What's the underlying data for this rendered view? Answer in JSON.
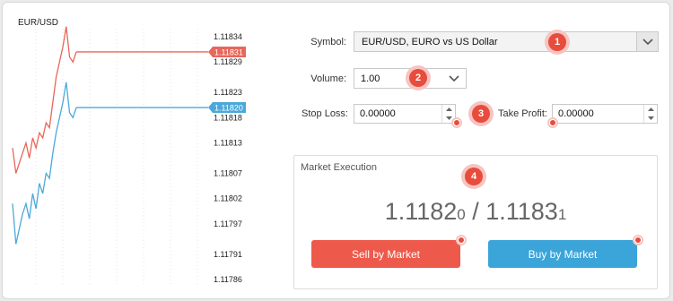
{
  "chart": {
    "symbol": "EUR/USD",
    "ask_value": "1.11831",
    "bid_value": "1.11820",
    "ask_color": "#e8665a",
    "bid_color": "#4ba9d9",
    "tick_labels": [
      "1.11834",
      "1.11829",
      "1.11823",
      "1.11818",
      "1.11813",
      "1.11807",
      "1.11802",
      "1.11797",
      "1.11791",
      "1.11786"
    ],
    "ask_series": [
      1.11812,
      1.11807,
      1.11809,
      1.11811,
      1.11813,
      1.1181,
      1.11814,
      1.11812,
      1.11815,
      1.11814,
      1.11817,
      1.11816,
      1.11821,
      1.11826,
      1.11829,
      1.11832,
      1.11836,
      1.1183,
      1.11829,
      1.11831
    ],
    "bid_series": [
      1.11801,
      1.11793,
      1.11796,
      1.11799,
      1.11801,
      1.11798,
      1.11803,
      1.118,
      1.11805,
      1.11803,
      1.11807,
      1.11806,
      1.11811,
      1.11815,
      1.11818,
      1.11821,
      1.11825,
      1.11819,
      1.11818,
      1.1182
    ]
  },
  "form": {
    "symbol_label": "Symbol:",
    "symbol_value": "EUR/USD, EURO vs US Dollar",
    "volume_label": "Volume:",
    "volume_value": "1.00",
    "stop_loss_label": "Stop Loss:",
    "stop_loss_value": "0.00000",
    "take_profit_label": "Take Profit:",
    "take_profit_value": "0.00000"
  },
  "badges": [
    "1",
    "2",
    "3",
    "4"
  ],
  "execution": {
    "title": "Market Execution",
    "bid_main": "1.1182",
    "bid_small": "0",
    "separator": " / ",
    "ask_main": "1.1183",
    "ask_small": "1",
    "sell_label": "Sell by Market",
    "buy_label": "Buy by Market"
  },
  "colors": {
    "sell": "#ed5a4b",
    "buy": "#3ba4d9",
    "badge": "#e74c3c"
  }
}
